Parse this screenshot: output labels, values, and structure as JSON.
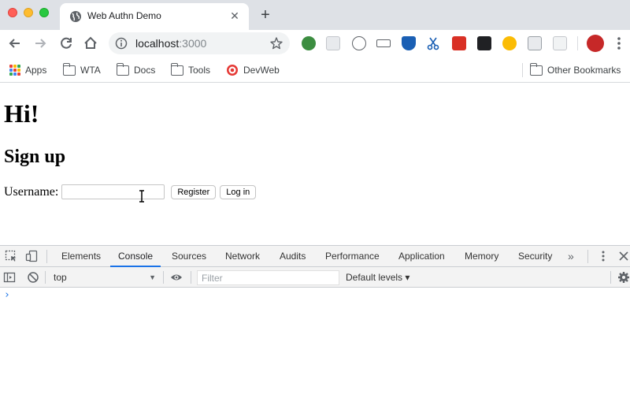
{
  "window": {
    "tab_title": "Web Authn Demo",
    "tab_close_glyph": "✕",
    "new_tab_glyph": "+"
  },
  "address_bar": {
    "host": "localhost",
    "port": ":3000"
  },
  "bookmarks": [
    {
      "label": "Apps",
      "icon": "apps-grid-icon"
    },
    {
      "label": "WTA",
      "icon": "folder-icon"
    },
    {
      "label": "Docs",
      "icon": "folder-icon"
    },
    {
      "label": "Tools",
      "icon": "folder-icon"
    },
    {
      "label": "DevWeb",
      "icon": "target-icon"
    }
  ],
  "other_bookmarks": "Other Bookmarks",
  "page": {
    "heading": "Hi!",
    "subheading": "Sign up",
    "username_label": "Username:",
    "register_button": "Register",
    "login_button": "Log in"
  },
  "devtools": {
    "tabs": [
      "Elements",
      "Console",
      "Sources",
      "Network",
      "Audits",
      "Performance",
      "Application",
      "Memory",
      "Security"
    ],
    "active_tab": "Console",
    "more_tabs_glyph": "»",
    "context": "top",
    "context_arrow": "▼",
    "filter_placeholder": "Filter",
    "levels": "Default levels ▾",
    "prompt": "›"
  },
  "colors": {
    "tab_strip": "#dee1e6",
    "accent": "#1a73e8",
    "close": "#ff5f57",
    "minimize": "#febc2e",
    "maximize": "#28c840"
  }
}
